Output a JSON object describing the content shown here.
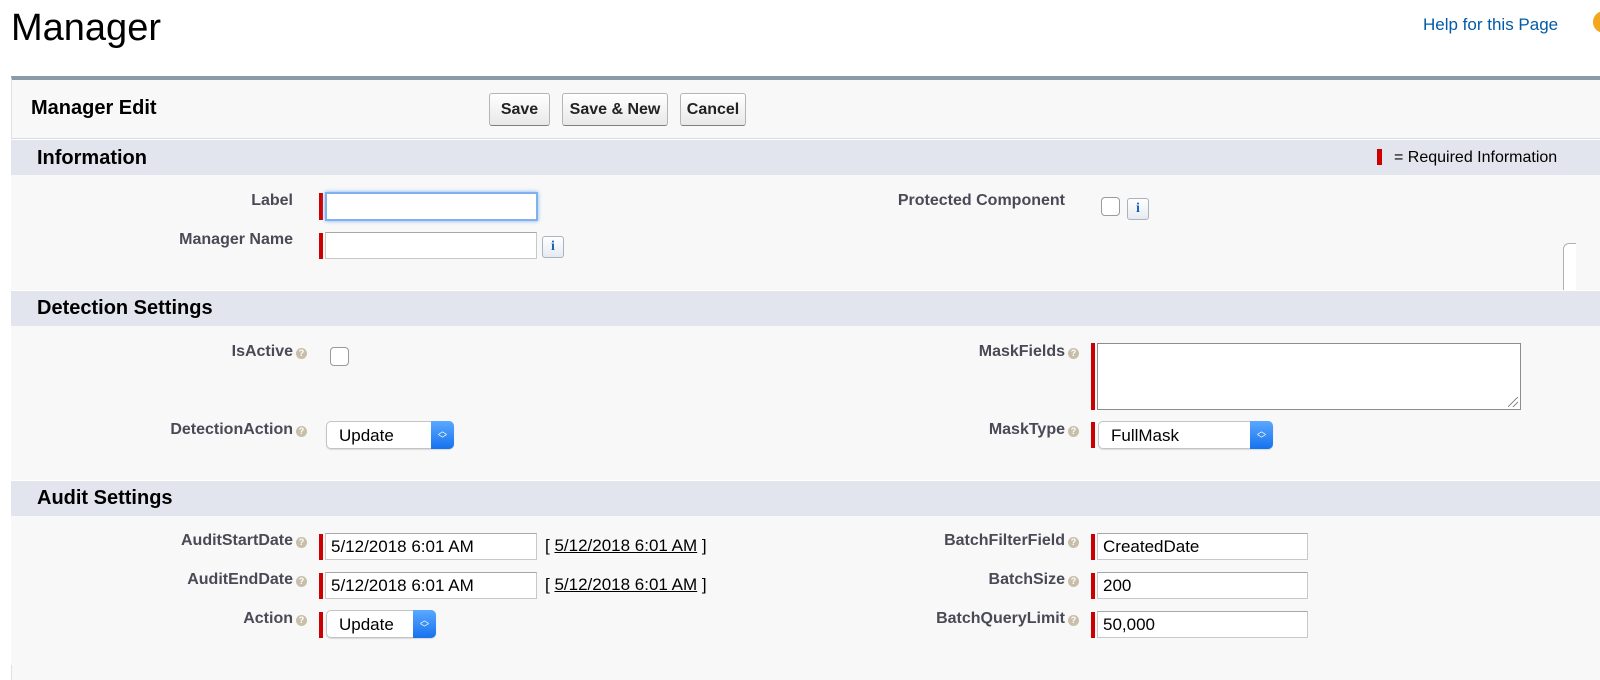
{
  "header": {
    "title": "Manager",
    "help_link": "Help for this Page"
  },
  "edit_panel": {
    "title": "Manager Edit",
    "buttons": {
      "save": "Save",
      "save_new": "Save & New",
      "cancel": "Cancel"
    }
  },
  "required_legend": "= Required Information",
  "sections": {
    "information": {
      "title": "Information",
      "label_field": {
        "label": "Label",
        "value": ""
      },
      "manager_name_field": {
        "label": "Manager Name",
        "value": ""
      },
      "protected_component": {
        "label": "Protected Component",
        "checked": false
      }
    },
    "detection": {
      "title": "Detection Settings",
      "is_active": {
        "label": "IsActive",
        "checked": false
      },
      "detection_action": {
        "label": "DetectionAction",
        "value": "Update"
      },
      "mask_fields": {
        "label": "MaskFields",
        "value": ""
      },
      "mask_type": {
        "label": "MaskType",
        "value": "FullMask"
      }
    },
    "audit": {
      "title": "Audit Settings",
      "audit_start_date": {
        "label": "AuditStartDate",
        "value": "5/12/2018 6:01 AM",
        "link": "5/12/2018 6:01 AM"
      },
      "audit_end_date": {
        "label": "AuditEndDate",
        "value": "5/12/2018 6:01 AM",
        "link": "5/12/2018 6:01 AM"
      },
      "action": {
        "label": "Action",
        "value": "Update"
      },
      "batch_filter_field": {
        "label": "BatchFilterField",
        "value": "CreatedDate"
      },
      "batch_size": {
        "label": "BatchSize",
        "value": "200"
      },
      "batch_query_limit": {
        "label": "BatchQueryLimit",
        "value": "50,000"
      }
    }
  },
  "icons": {
    "help_orb": "help-orb-icon",
    "info": "info-icon",
    "field_help": "help-bubble-icon",
    "select_arrows": "chevron-up-down-icon"
  },
  "colors": {
    "required": "#cc0000",
    "link": "#015ba7",
    "section_header": "#e3e5ee",
    "panel_top_border": "#8a9aa6",
    "select_arrow": "#1672ee"
  }
}
